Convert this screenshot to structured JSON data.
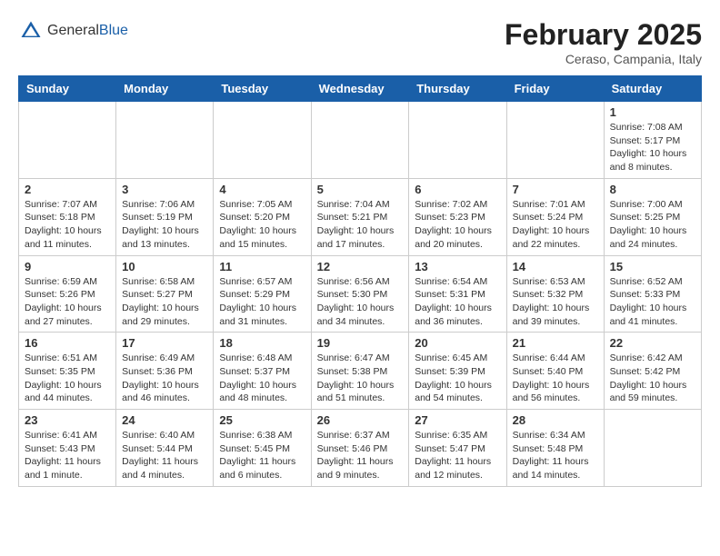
{
  "header": {
    "logo_general": "General",
    "logo_blue": "Blue",
    "month_year": "February 2025",
    "location": "Ceraso, Campania, Italy"
  },
  "calendar": {
    "days_of_week": [
      "Sunday",
      "Monday",
      "Tuesday",
      "Wednesday",
      "Thursday",
      "Friday",
      "Saturday"
    ],
    "weeks": [
      [
        {
          "day": "",
          "info": ""
        },
        {
          "day": "",
          "info": ""
        },
        {
          "day": "",
          "info": ""
        },
        {
          "day": "",
          "info": ""
        },
        {
          "day": "",
          "info": ""
        },
        {
          "day": "",
          "info": ""
        },
        {
          "day": "1",
          "info": "Sunrise: 7:08 AM\nSunset: 5:17 PM\nDaylight: 10 hours and 8 minutes."
        }
      ],
      [
        {
          "day": "2",
          "info": "Sunrise: 7:07 AM\nSunset: 5:18 PM\nDaylight: 10 hours and 11 minutes."
        },
        {
          "day": "3",
          "info": "Sunrise: 7:06 AM\nSunset: 5:19 PM\nDaylight: 10 hours and 13 minutes."
        },
        {
          "day": "4",
          "info": "Sunrise: 7:05 AM\nSunset: 5:20 PM\nDaylight: 10 hours and 15 minutes."
        },
        {
          "day": "5",
          "info": "Sunrise: 7:04 AM\nSunset: 5:21 PM\nDaylight: 10 hours and 17 minutes."
        },
        {
          "day": "6",
          "info": "Sunrise: 7:02 AM\nSunset: 5:23 PM\nDaylight: 10 hours and 20 minutes."
        },
        {
          "day": "7",
          "info": "Sunrise: 7:01 AM\nSunset: 5:24 PM\nDaylight: 10 hours and 22 minutes."
        },
        {
          "day": "8",
          "info": "Sunrise: 7:00 AM\nSunset: 5:25 PM\nDaylight: 10 hours and 24 minutes."
        }
      ],
      [
        {
          "day": "9",
          "info": "Sunrise: 6:59 AM\nSunset: 5:26 PM\nDaylight: 10 hours and 27 minutes."
        },
        {
          "day": "10",
          "info": "Sunrise: 6:58 AM\nSunset: 5:27 PM\nDaylight: 10 hours and 29 minutes."
        },
        {
          "day": "11",
          "info": "Sunrise: 6:57 AM\nSunset: 5:29 PM\nDaylight: 10 hours and 31 minutes."
        },
        {
          "day": "12",
          "info": "Sunrise: 6:56 AM\nSunset: 5:30 PM\nDaylight: 10 hours and 34 minutes."
        },
        {
          "day": "13",
          "info": "Sunrise: 6:54 AM\nSunset: 5:31 PM\nDaylight: 10 hours and 36 minutes."
        },
        {
          "day": "14",
          "info": "Sunrise: 6:53 AM\nSunset: 5:32 PM\nDaylight: 10 hours and 39 minutes."
        },
        {
          "day": "15",
          "info": "Sunrise: 6:52 AM\nSunset: 5:33 PM\nDaylight: 10 hours and 41 minutes."
        }
      ],
      [
        {
          "day": "16",
          "info": "Sunrise: 6:51 AM\nSunset: 5:35 PM\nDaylight: 10 hours and 44 minutes."
        },
        {
          "day": "17",
          "info": "Sunrise: 6:49 AM\nSunset: 5:36 PM\nDaylight: 10 hours and 46 minutes."
        },
        {
          "day": "18",
          "info": "Sunrise: 6:48 AM\nSunset: 5:37 PM\nDaylight: 10 hours and 48 minutes."
        },
        {
          "day": "19",
          "info": "Sunrise: 6:47 AM\nSunset: 5:38 PM\nDaylight: 10 hours and 51 minutes."
        },
        {
          "day": "20",
          "info": "Sunrise: 6:45 AM\nSunset: 5:39 PM\nDaylight: 10 hours and 54 minutes."
        },
        {
          "day": "21",
          "info": "Sunrise: 6:44 AM\nSunset: 5:40 PM\nDaylight: 10 hours and 56 minutes."
        },
        {
          "day": "22",
          "info": "Sunrise: 6:42 AM\nSunset: 5:42 PM\nDaylight: 10 hours and 59 minutes."
        }
      ],
      [
        {
          "day": "23",
          "info": "Sunrise: 6:41 AM\nSunset: 5:43 PM\nDaylight: 11 hours and 1 minute."
        },
        {
          "day": "24",
          "info": "Sunrise: 6:40 AM\nSunset: 5:44 PM\nDaylight: 11 hours and 4 minutes."
        },
        {
          "day": "25",
          "info": "Sunrise: 6:38 AM\nSunset: 5:45 PM\nDaylight: 11 hours and 6 minutes."
        },
        {
          "day": "26",
          "info": "Sunrise: 6:37 AM\nSunset: 5:46 PM\nDaylight: 11 hours and 9 minutes."
        },
        {
          "day": "27",
          "info": "Sunrise: 6:35 AM\nSunset: 5:47 PM\nDaylight: 11 hours and 12 minutes."
        },
        {
          "day": "28",
          "info": "Sunrise: 6:34 AM\nSunset: 5:48 PM\nDaylight: 11 hours and 14 minutes."
        },
        {
          "day": "",
          "info": ""
        }
      ]
    ]
  }
}
